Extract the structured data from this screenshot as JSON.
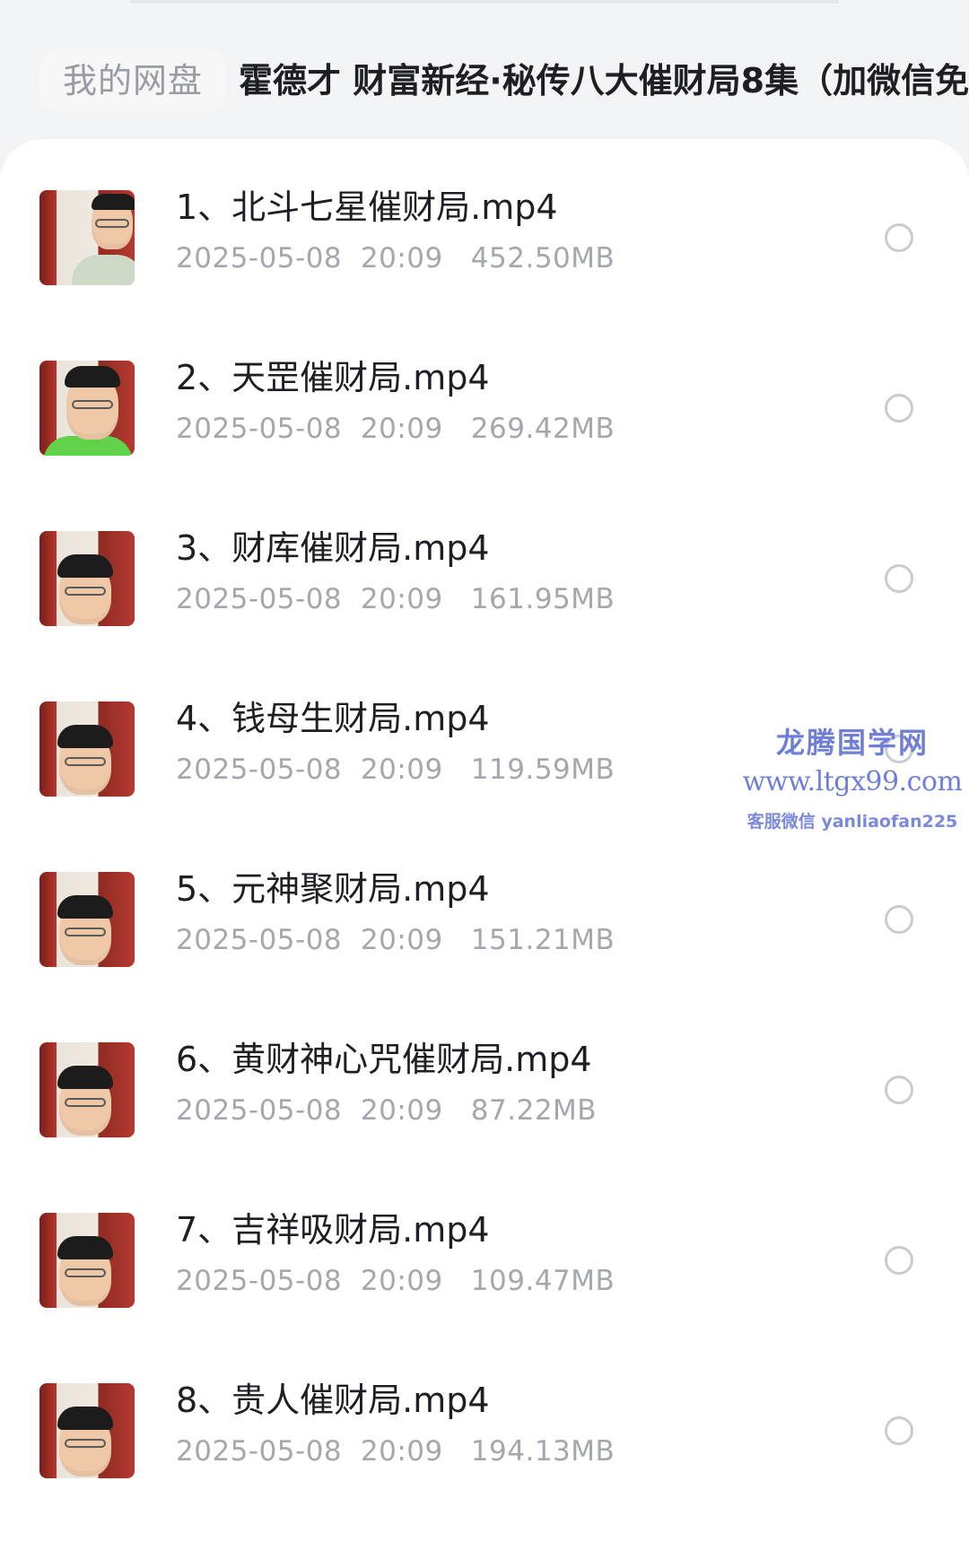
{
  "header": {
    "breadcrumb_root": "我的网盘",
    "breadcrumb_current": "霍德才 财富新经·秘传八大催财局8集（加微信免"
  },
  "files": [
    {
      "name": "1、北斗七星催财局.mp4",
      "date": "2025-05-08",
      "time": "20:09",
      "size": "452.50MB",
      "selected": false
    },
    {
      "name": "2、天罡催财局.mp4",
      "date": "2025-05-08",
      "time": "20:09",
      "size": "269.42MB",
      "selected": false
    },
    {
      "name": "3、财库催财局.mp4",
      "date": "2025-05-08",
      "time": "20:09",
      "size": "161.95MB",
      "selected": false
    },
    {
      "name": "4、钱母生财局.mp4",
      "date": "2025-05-08",
      "time": "20:09",
      "size": "119.59MB",
      "selected": false
    },
    {
      "name": "5、元神聚财局.mp4",
      "date": "2025-05-08",
      "time": "20:09",
      "size": "151.21MB",
      "selected": false
    },
    {
      "name": "6、黄财神心咒催财局.mp4",
      "date": "2025-05-08",
      "time": "20:09",
      "size": "87.22MB",
      "selected": false
    },
    {
      "name": "7、吉祥吸财局.mp4",
      "date": "2025-05-08",
      "time": "20:09",
      "size": "109.47MB",
      "selected": false
    },
    {
      "name": "8、贵人催财局.mp4",
      "date": "2025-05-08",
      "time": "20:09",
      "size": "194.13MB",
      "selected": false
    }
  ],
  "watermark": {
    "title": "龙腾国学网",
    "url": "www.ltgx99.com",
    "contact": "客服微信 yanliaofan225"
  },
  "colors": {
    "accent": "#6f7fd8",
    "text_primary": "#1e1f24",
    "text_secondary": "#a4a7ae",
    "background": "#f3f4f6"
  }
}
